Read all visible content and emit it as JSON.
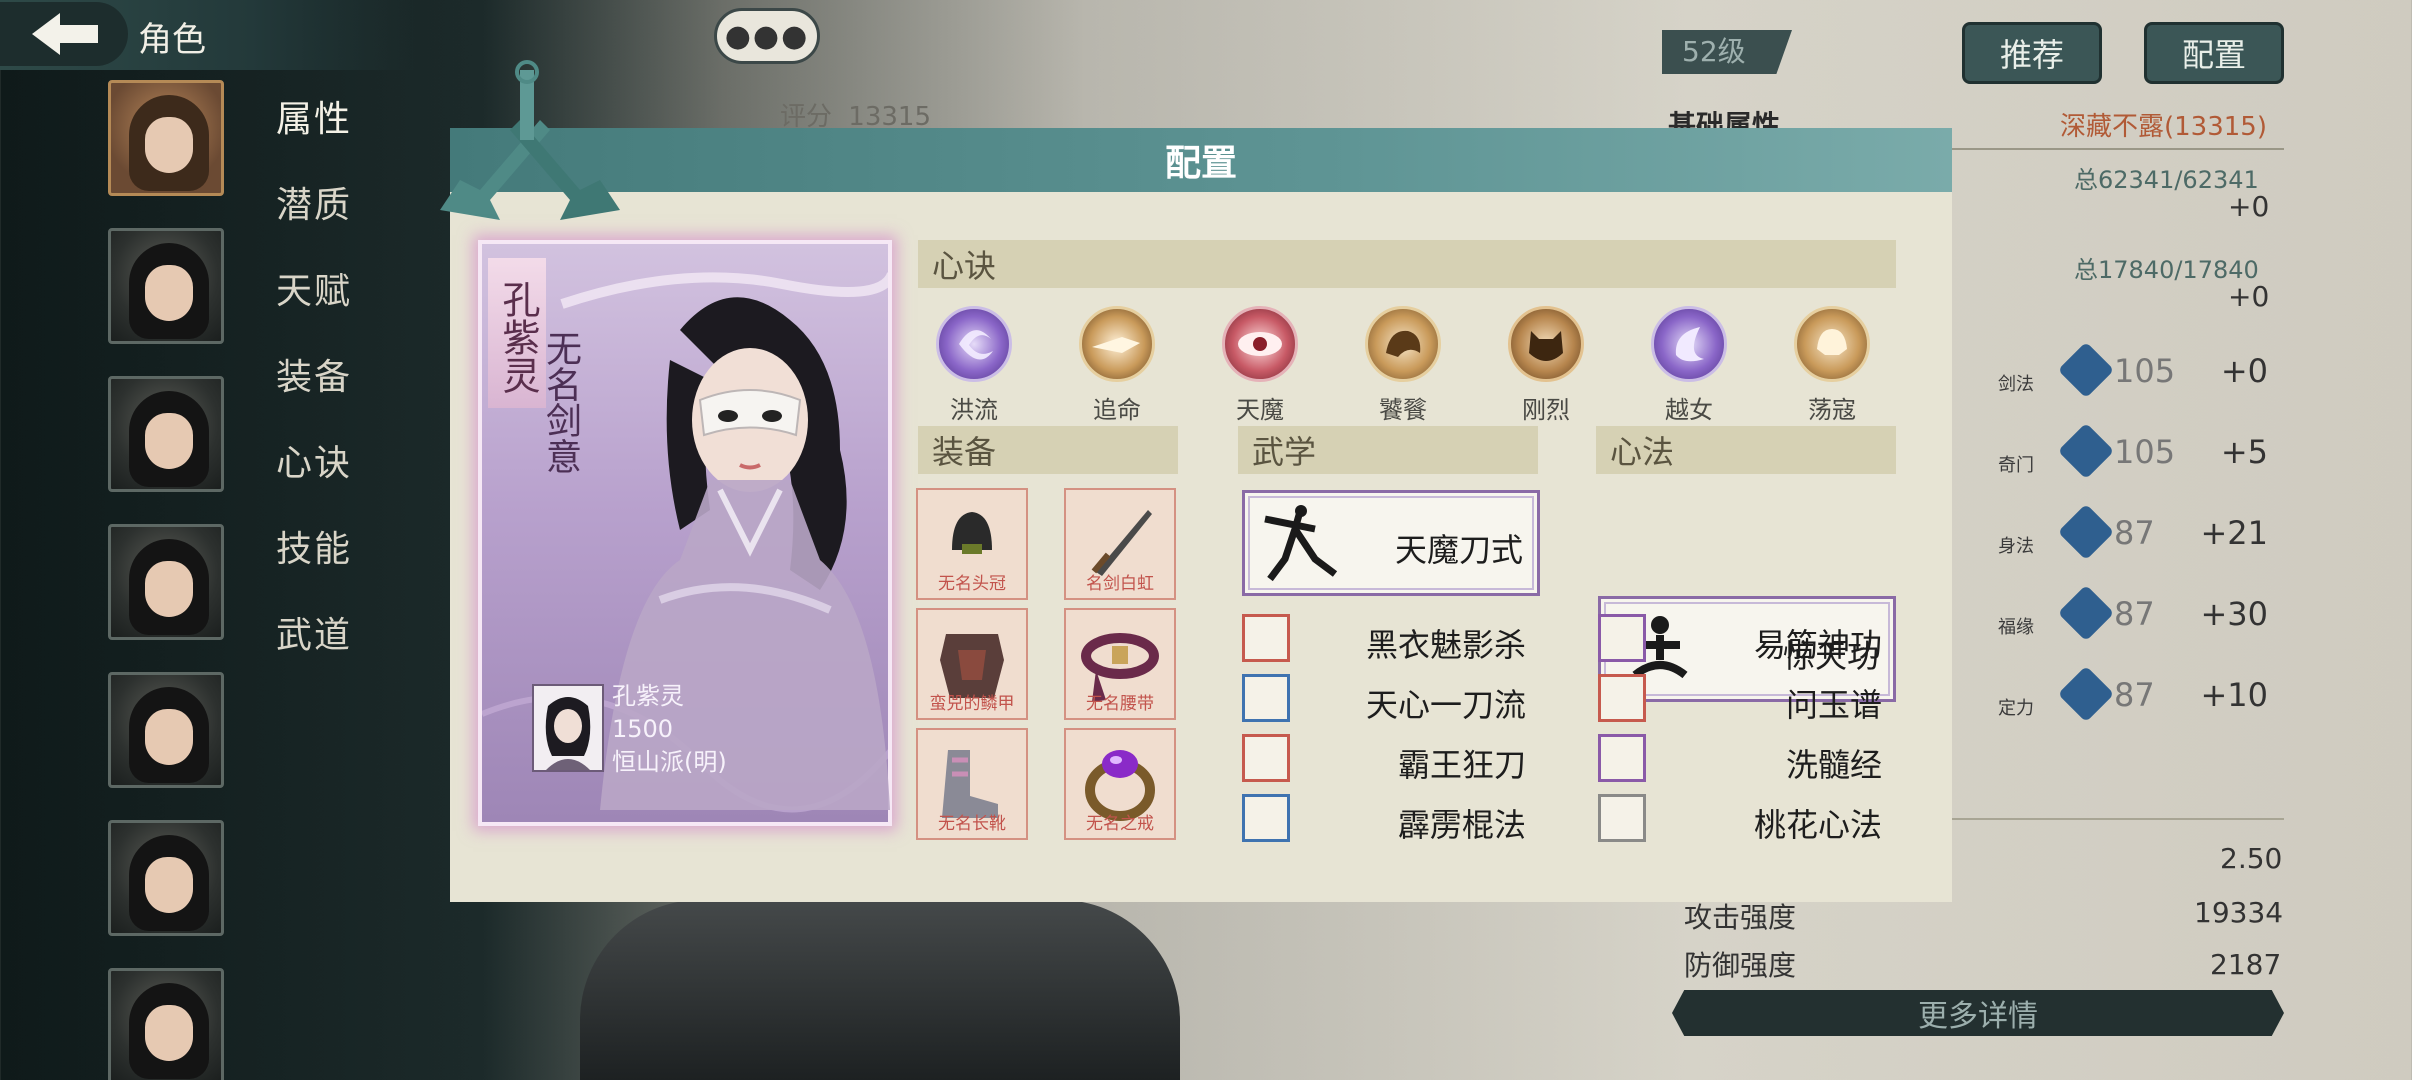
{
  "topbar": {
    "title": "角色"
  },
  "side_menu": [
    "属性",
    "潜质",
    "天赋",
    "装备",
    "心诀",
    "技能",
    "武道"
  ],
  "background": {
    "level": "52级",
    "recommend_label": "推荐",
    "config_label": "配置",
    "rating_label": "评分",
    "rating_value": "13315",
    "base_attr_label": "基础属性",
    "hidden_power": "深藏不露(13315)",
    "hp_total": "总62341/62341",
    "hp_delta": "+0",
    "mp_total": "总17840/17840",
    "mp_delta": "+0",
    "stats": [
      {
        "name": "剑法",
        "value": "105",
        "delta": "+0"
      },
      {
        "name": "奇门",
        "value": "105",
        "delta": "+5"
      },
      {
        "name": "身法",
        "value": "87",
        "delta": "+21"
      },
      {
        "name": "福缘",
        "value": "87",
        "delta": "+30"
      },
      {
        "name": "定力",
        "value": "87",
        "delta": "+10"
      }
    ],
    "crit_value": "2.50",
    "attack_label": "攻击强度",
    "attack_value": "19334",
    "defense_label": "防御强度",
    "defense_value": "2187",
    "more_label": "更多详情"
  },
  "modal": {
    "title": "配置",
    "character": {
      "name": "孔紫灵",
      "title": "无名剑意",
      "info_name": "孔紫灵",
      "info_value": "1500",
      "info_sect": "恒山派(明)"
    },
    "heart_section": "心诀",
    "hearts": [
      {
        "label": "洪流",
        "icon": "vortex-icon",
        "color": "#8a66c8"
      },
      {
        "label": "追命",
        "icon": "fire-dash-icon",
        "color": "#c99a5a"
      },
      {
        "label": "天魔",
        "icon": "demon-eye-icon",
        "color": "#c85a66"
      },
      {
        "label": "饕餮",
        "icon": "beast-icon",
        "color": "#c99a5a"
      },
      {
        "label": "刚烈",
        "icon": "tiger-face-icon",
        "color": "#b7864e"
      },
      {
        "label": "越女",
        "icon": "crescent-icon",
        "color": "#8a66c8"
      },
      {
        "label": "荡寇",
        "icon": "helmet-icon",
        "color": "#c99a5a"
      }
    ],
    "equip_section": "装备",
    "equipment": [
      {
        "label": "无名头冠",
        "icon": "crown-icon"
      },
      {
        "label": "名剑白虹",
        "icon": "sword-icon"
      },
      {
        "label": "蛮兕的鳞甲",
        "icon": "armor-icon"
      },
      {
        "label": "无名腰带",
        "icon": "belt-icon"
      },
      {
        "label": "无名长靴",
        "icon": "boots-icon"
      },
      {
        "label": "无名之戒",
        "icon": "ring-icon"
      }
    ],
    "martial_section": "武学",
    "martial_main": "天魔刀式",
    "martial_list": [
      {
        "label": "黑衣魅影杀",
        "color": "#c65a4e"
      },
      {
        "label": "天心一刀流",
        "color": "#3f73b0"
      },
      {
        "label": "霸王狂刀",
        "color": "#c65a4e"
      },
      {
        "label": "霹雳棍法",
        "color": "#3f73b0"
      }
    ],
    "inner_section": "心法",
    "inner_main": "惊天功",
    "inner_list": [
      {
        "label": "易筋神功",
        "color": "#8a5aa8"
      },
      {
        "label": "问玉谱",
        "color": "#c65a4e"
      },
      {
        "label": "洗髓经",
        "color": "#8a5aa8"
      },
      {
        "label": "桃花心法",
        "color": "#8a8a88"
      }
    ]
  }
}
